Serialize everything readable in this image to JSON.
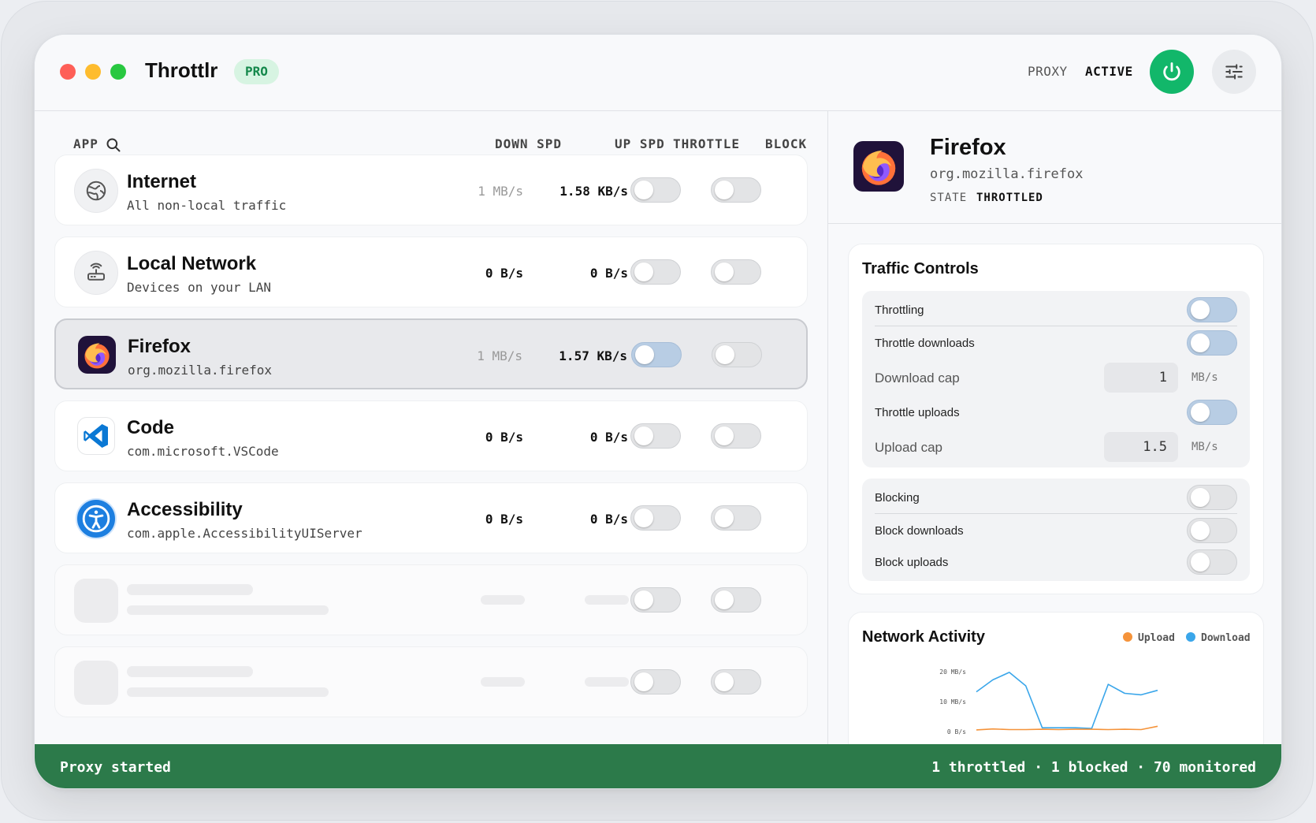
{
  "window": {
    "title": "Throttlr",
    "badge": "PRO",
    "proxy_label": "PROXY",
    "proxy_state": "ACTIVE"
  },
  "table": {
    "headers": {
      "app": "APP",
      "down": "DOWN SPD",
      "up": "UP SPD",
      "throttle": "THROTTLE",
      "block": "BLOCK"
    },
    "rows": [
      {
        "name": "Internet",
        "sub": "All non-local traffic",
        "down": "1 MB/s",
        "up": "1.58 KB/s",
        "throttle": false,
        "block": false,
        "icon": "globe-icon"
      },
      {
        "name": "Local Network",
        "sub": "Devices on your LAN",
        "down": "0 B/s",
        "up": "0 B/s",
        "throttle": false,
        "block": false,
        "icon": "router-icon"
      },
      {
        "name": "Firefox",
        "sub": "org.mozilla.firefox",
        "down": "1 MB/s",
        "up": "1.57 KB/s",
        "throttle": true,
        "block": false,
        "icon": "firefox-icon",
        "selected": true
      },
      {
        "name": "Code",
        "sub": "com.microsoft.VSCode",
        "down": "0 B/s",
        "up": "0 B/s",
        "throttle": false,
        "block": false,
        "icon": "vscode-icon"
      },
      {
        "name": "Accessibility",
        "sub": "com.apple.AccessibilityUIServer",
        "down": "0 B/s",
        "up": "0 B/s",
        "throttle": false,
        "block": false,
        "icon": "accessibility-icon"
      }
    ]
  },
  "detail": {
    "name": "Firefox",
    "bundle_id": "org.mozilla.firefox",
    "state_label": "STATE",
    "state_value": "THROTTLED"
  },
  "traffic_controls": {
    "title": "Traffic Controls",
    "throttling": "Throttling",
    "throttle_downloads": "Throttle downloads",
    "download_cap_label": "Download cap",
    "download_cap_value": "1",
    "download_cap_unit": "MB/s",
    "throttle_uploads": "Throttle uploads",
    "upload_cap_label": "Upload cap",
    "upload_cap_value": "1.5",
    "upload_cap_unit": "MB/s",
    "blocking": "Blocking",
    "block_downloads": "Block downloads",
    "block_uploads": "Block uploads"
  },
  "network_activity": {
    "title": "Network Activity",
    "legend_upload": "Upload",
    "legend_download": "Download",
    "colors": {
      "upload": "#f5933a",
      "download": "#3aa6ea"
    }
  },
  "chart_data": {
    "type": "line",
    "x": [
      0,
      1,
      2,
      3,
      4,
      5,
      6,
      7,
      8,
      9,
      10
    ],
    "series": [
      {
        "name": "Download",
        "values": [
          13,
          17,
          19.5,
          15,
          1,
          1,
          1,
          0.8,
          15.5,
          12.5,
          12,
          13.5
        ]
      },
      {
        "name": "Upload",
        "values": [
          0.3,
          0.6,
          0.4,
          0.4,
          0.5,
          0.4,
          0.5,
          0.5,
          0.4,
          0.5,
          0.4,
          1.5
        ]
      }
    ],
    "yticks": [
      "20 MB/s",
      "10 MB/s",
      "0 B/s"
    ],
    "ylim": [
      0,
      20
    ]
  },
  "status": {
    "left": "Proxy started",
    "right": "1 throttled · 1 blocked · 70 monitored"
  }
}
